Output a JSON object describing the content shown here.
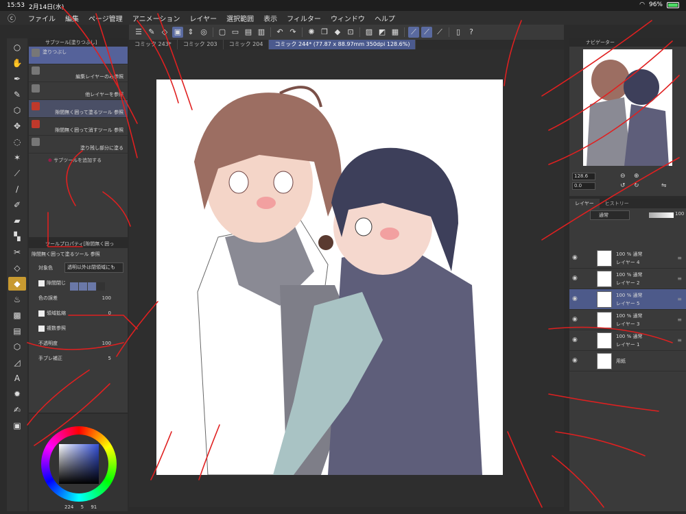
{
  "status": {
    "time": "15:53",
    "date": "2月14日(水)",
    "battery": "96%"
  },
  "menu": [
    "ファイル",
    "編集",
    "ページ管理",
    "アニメーション",
    "レイヤー",
    "選択範囲",
    "表示",
    "フィルター",
    "ウィンドウ",
    "ヘルプ"
  ],
  "tabs": [
    {
      "label": "コミック 243*"
    },
    {
      "label": "コミック 203"
    },
    {
      "label": "コミック 204"
    },
    {
      "label": "コミック 244* (77.87 x 88.97mm 350dpi 128.6%)"
    }
  ],
  "subtool": {
    "panel_title": "サブツール[塗りつぶし]",
    "items": [
      {
        "label": "塗りつぶし"
      },
      {
        "label": "編集レイヤーのみ参照"
      },
      {
        "label": "他レイヤーを参照"
      },
      {
        "label": "隙間無く囲って塗るツール 参照"
      },
      {
        "label": "隙間無く囲って消すツール 参照"
      },
      {
        "label": "塗り残し部分に塗る"
      }
    ],
    "add_label": "サブツールを追加する"
  },
  "toolprop": {
    "panel_title": "ツールプロパティ[隙間無く囲っ",
    "title": "隙間無く囲って塗るツール 参照",
    "target_color_label": "対象色",
    "target_color_value": "透明以外は閉領域にも",
    "gap_label": "隙間閉じ",
    "color_margin_label": "色の誤差",
    "color_margin_value": "100",
    "area_scaling_label": "領域拡縮",
    "area_scaling_value": "0",
    "multi_ref_label": "複数参照",
    "opacity_label": "不透明度",
    "opacity_value": "100",
    "stabilization_label": "手ブレ補正",
    "stabilization_value": "5"
  },
  "color": {
    "readout_h": "224",
    "readout_s": "5",
    "readout_v": "91"
  },
  "navigator": {
    "title": "ナビゲーター",
    "zoom": "128.6",
    "rotate": "0.0"
  },
  "layers": {
    "tab_layer": "レイヤー",
    "tab_history": "ヒストリー",
    "blend_mode": "通常",
    "opacity": "100",
    "items": [
      {
        "pct": "100 % 通常",
        "name": "レイヤー 4"
      },
      {
        "pct": "100 % 通常",
        "name": "レイヤー 2"
      },
      {
        "pct": "100 % 通常",
        "name": "レイヤー 5"
      },
      {
        "pct": "100 % 通常",
        "name": "レイヤー 3"
      },
      {
        "pct": "100 % 通常",
        "name": "レイヤー 1"
      },
      {
        "pct": "",
        "name": "用紙"
      }
    ]
  }
}
